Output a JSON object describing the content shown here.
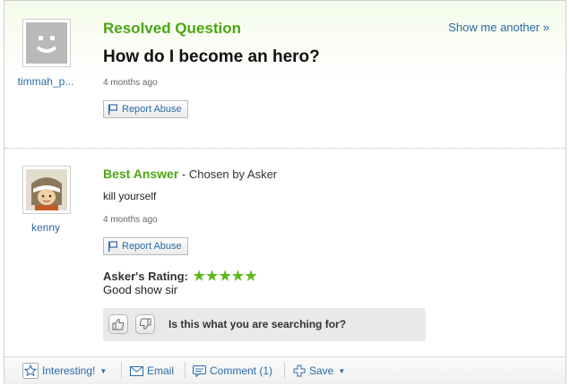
{
  "question": {
    "status_label": "Resolved Question",
    "title": "How do I become an hero?",
    "time": "4 months ago",
    "report_label": "Report Abuse",
    "show_another": "Show me another »",
    "asker": "timmah_p..."
  },
  "answer": {
    "best_label": "Best Answer",
    "chosen_by": " - Chosen by Asker",
    "text": "kill yourself",
    "time": "4 months ago",
    "report_label": "Report Abuse",
    "answerer": "kenny",
    "rating_label": "Asker's Rating:",
    "stars": "★★★★★",
    "rating_comment": "Good show sir"
  },
  "search_prompt": {
    "text": "Is this what you are searching for?"
  },
  "toolbar": {
    "interesting": "Interesting!",
    "email": "Email",
    "comment": "Comment (1)",
    "save": "Save"
  },
  "colors": {
    "accent_green": "#4aa513",
    "link_blue": "#2b6aa8",
    "star_green": "#5dbb18"
  },
  "icons": [
    "default-avatar-icon",
    "kenny-avatar-icon",
    "flag-icon",
    "thumbs-up-icon",
    "thumbs-down-icon",
    "star-icon",
    "email-icon",
    "comment-icon",
    "save-plus-icon",
    "chevron-down-icon"
  ]
}
